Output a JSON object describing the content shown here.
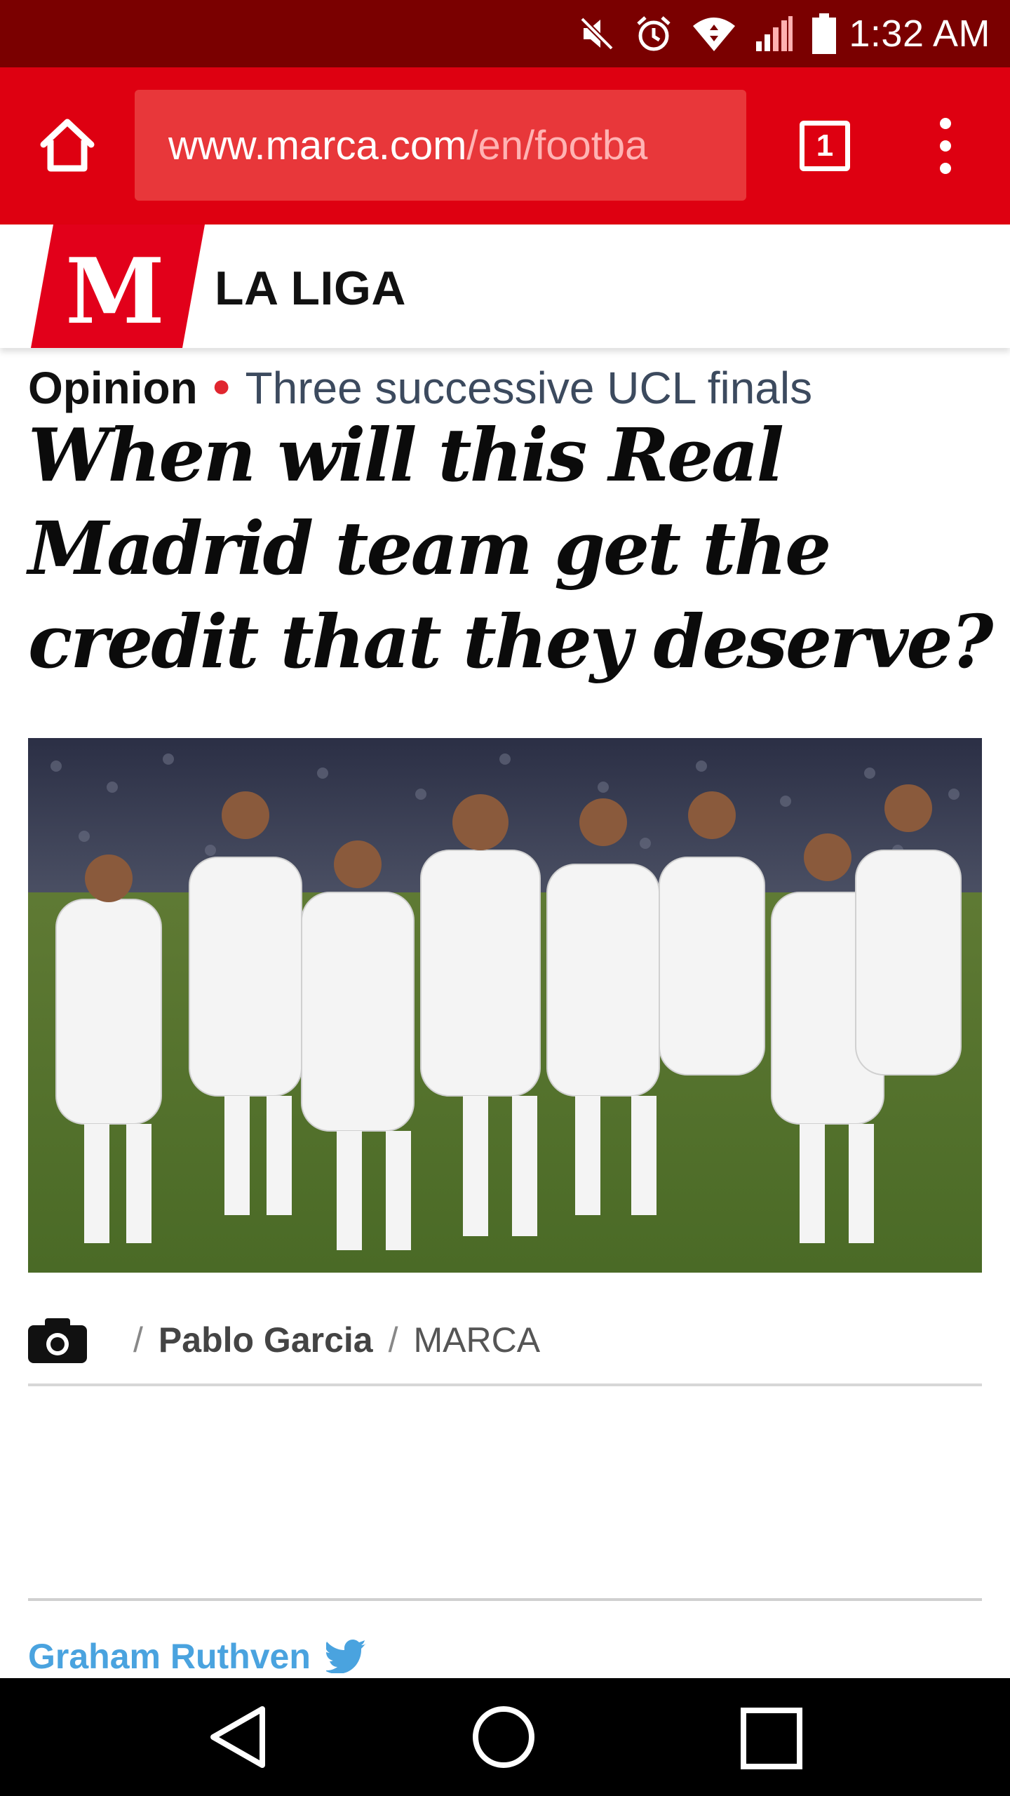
{
  "status_bar": {
    "time": "1:32 AM",
    "icons": [
      "muted-speaker-icon",
      "alarm-icon",
      "wifi-icon",
      "signal-icon",
      "battery-icon"
    ]
  },
  "browser": {
    "url_host": "www.marca.com",
    "url_path": "/en/footba",
    "tab_count": "1",
    "colors": {
      "toolbar": "#de0011",
      "status_bar": "#7a0000"
    }
  },
  "site": {
    "logo_letter": "M",
    "section": "LA LIGA"
  },
  "article": {
    "kicker_label": "Opinion",
    "kicker_topic": "Three successive UCL finals",
    "headline": "When will this Real Madrid team get the credit that they deserve?",
    "photo_alt": "Real Madrid players lined up on the pitch",
    "photo_credit_author": "Pablo Garcia",
    "photo_credit_source": "MARCA",
    "author_name": "Graham Ruthven"
  },
  "nav": {
    "buttons": [
      "back",
      "home",
      "recents"
    ]
  }
}
